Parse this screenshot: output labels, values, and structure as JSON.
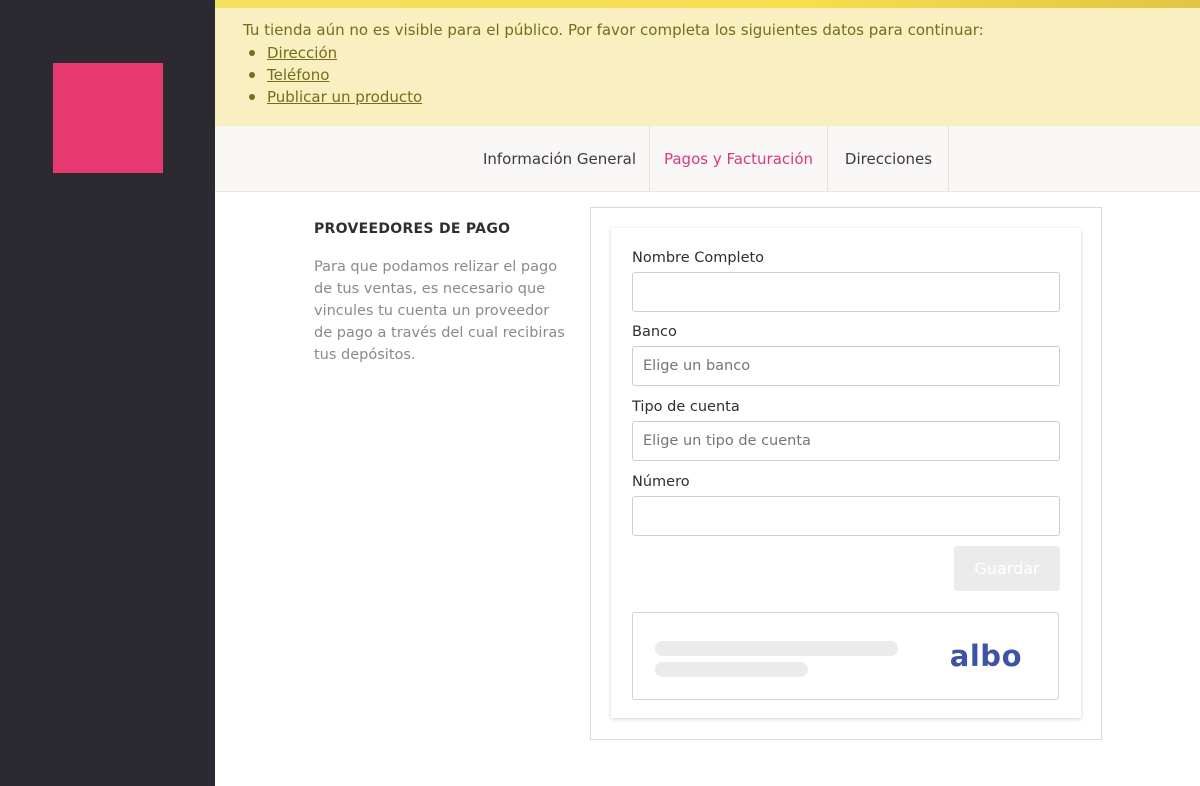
{
  "sidebar": {
    "logo_icon": "brand-logo-square",
    "logo_color": "#e83872",
    "background": "#2b2a30"
  },
  "banner": {
    "message": "Tu tienda aún no es visible para el público. Por favor completa los siguientes datos para continuar:",
    "items": [
      {
        "label": "Dirección"
      },
      {
        "label": "Teléfono"
      },
      {
        "label": "Publicar un producto"
      }
    ]
  },
  "tabs": [
    {
      "label": "Información General"
    },
    {
      "label": "Pagos y Facturación",
      "active": true
    },
    {
      "label": "Direcciones"
    }
  ],
  "section": {
    "title": "PROVEEDORES DE PAGO",
    "description": "Para que podamos relizar el pago de tus ventas, es necesario que vincules tu cuenta un proveedor de pago a través del cual recibiras tus depósitos."
  },
  "form": {
    "full_name": {
      "label": "Nombre Completo",
      "value": "",
      "placeholder": ""
    },
    "bank": {
      "label": "Banco",
      "placeholder": "Elige un banco"
    },
    "account_type": {
      "label": "Tipo de cuenta",
      "placeholder": "Elige un tipo de cuenta"
    },
    "number": {
      "label": "Número",
      "value": "",
      "placeholder": ""
    },
    "save_label": "Guardar"
  },
  "provider": {
    "name": "albo",
    "brand_color": "#3f53a4"
  },
  "colors": {
    "accent": "#d63a7e",
    "banner_bg": "#f9efc1",
    "banner_text": "#7a6a1b"
  }
}
